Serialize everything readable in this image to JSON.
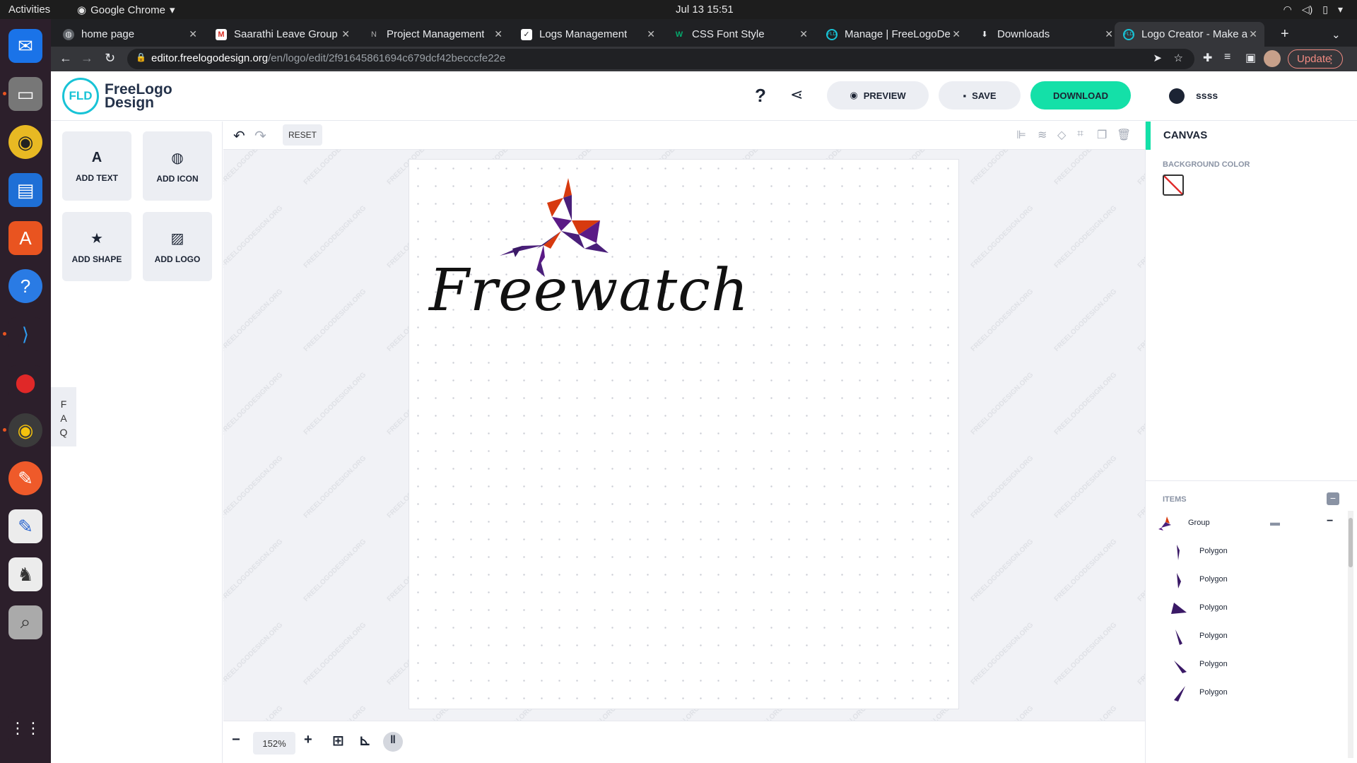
{
  "os": {
    "activities": "Activities",
    "app_name": "Google Chrome",
    "clock": "Jul 13  15:51"
  },
  "browser": {
    "tabs": [
      {
        "label": "home page",
        "icon": "globe-icon"
      },
      {
        "label": "Saarathi Leave Group",
        "icon": "gmail-icon"
      },
      {
        "label": "Project Management",
        "icon": "notion-icon"
      },
      {
        "label": "Logs Management",
        "icon": "check-icon"
      },
      {
        "label": "CSS Font Style",
        "icon": "w3-icon"
      },
      {
        "label": "Manage | FreeLogoDe",
        "icon": "fld-icon"
      },
      {
        "label": "Downloads",
        "icon": "download-icon"
      },
      {
        "label": "Logo Creator - Make a",
        "icon": "fld-icon"
      }
    ],
    "url_host": "editor.freelogodesign.org",
    "url_path": "/en/logo/edit/2f91645861694c679dcf42becccfe22e",
    "update_label": "Update"
  },
  "header": {
    "logo_abbrev": "FLD",
    "logo_line1": "FreeLogo",
    "logo_line2": "Design",
    "help": "?",
    "preview": "PREVIEW",
    "save": "SAVE",
    "download": "DOWNLOAD",
    "username": "ssss",
    "accent": "#14e0a8"
  },
  "left_panel": {
    "add_text": "ADD TEXT",
    "add_icon": "ADD ICON",
    "add_shape": "ADD SHAPE",
    "add_logo": "ADD LOGO",
    "faq": [
      "F",
      "A",
      "Q"
    ]
  },
  "toolbar": {
    "reset": "RESET"
  },
  "canvas": {
    "brand_text": "Freewatch",
    "watermark": "FREELOGODESIGN.ORG"
  },
  "bottombar": {
    "zoom": "152%"
  },
  "right_panel": {
    "title": "CANVAS",
    "bg_label": "BACKGROUND COLOR",
    "items_label": "ITEMS",
    "items": [
      {
        "label": "Group"
      },
      {
        "label": "Polygon"
      },
      {
        "label": "Polygon"
      },
      {
        "label": "Polygon"
      },
      {
        "label": "Polygon"
      },
      {
        "label": "Polygon"
      },
      {
        "label": "Polygon"
      }
    ]
  }
}
